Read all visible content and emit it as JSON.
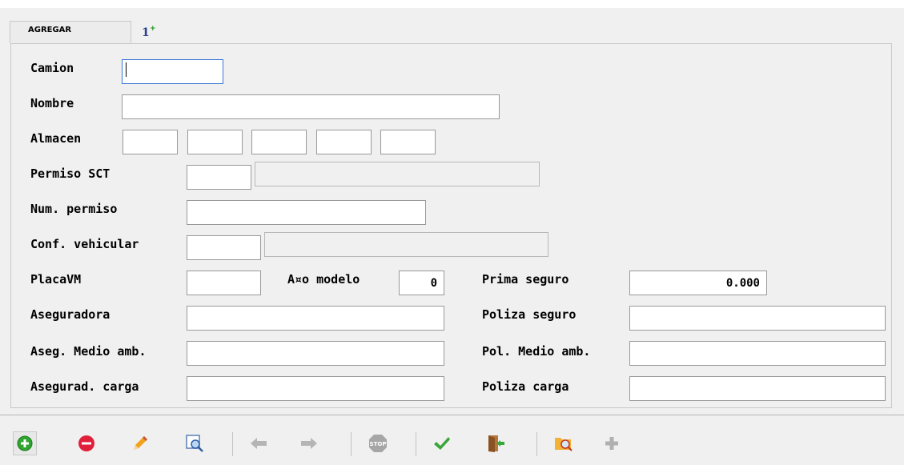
{
  "tab": {
    "label": "AGREGAR",
    "icon": "sort-numeric-add-icon",
    "icon_glyph": "1",
    "icon_plus": "+"
  },
  "form": {
    "camion_label": "Camion",
    "camion_value": "",
    "nombre_label": "Nombre",
    "nombre_value": "",
    "almacen_label": "Almacen",
    "almacen_values": [
      "",
      "",
      "",
      "",
      ""
    ],
    "permiso_sct_label": "Permiso SCT",
    "permiso_sct_code": "",
    "permiso_sct_desc": "",
    "num_permiso_label": "Num. permiso",
    "num_permiso_value": "",
    "conf_vehicular_label": "Conf. vehicular",
    "conf_vehicular_code": "",
    "conf_vehicular_desc": "",
    "placavm_label": "PlacaVM",
    "placavm_value": "",
    "anio_modelo_label": "A¤o modelo",
    "anio_modelo_value": "0",
    "prima_seguro_label": "Prima seguro",
    "prima_seguro_value": "0.000",
    "aseguradora_label": "Aseguradora",
    "aseguradora_value": "",
    "poliza_seguro_label": "Poliza seguro",
    "poliza_seguro_value": "",
    "aseg_medio_amb_label": "Aseg. Medio amb.",
    "aseg_medio_amb_value": "",
    "pol_medio_amb_label": "Pol. Medio amb.",
    "pol_medio_amb_value": "",
    "asegurad_carga_label": "Asegurad. carga",
    "asegurad_carga_value": "",
    "poliza_carga_label": "Poliza carga",
    "poliza_carga_value": ""
  },
  "toolbar": {
    "buttons": [
      "add-icon",
      "delete-icon",
      "edit-pencil-icon",
      "search-icon",
      "arrow-left-icon",
      "arrow-right-icon",
      "stop-icon",
      "checkmark-icon",
      "exit-door-icon",
      "folder-search-icon",
      "plus-icon"
    ],
    "stop_text": "STOP"
  },
  "colors": {
    "add": "#2fa52f",
    "delete": "#e0203a",
    "check": "#3aa63a",
    "focus_border": "#3a78d4"
  }
}
